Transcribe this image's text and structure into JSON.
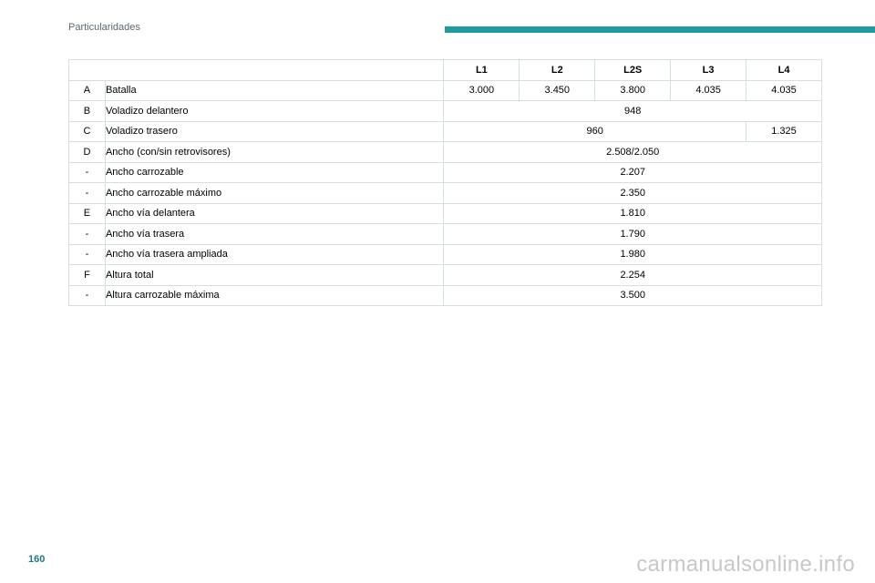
{
  "header": {
    "section_title": "Particularidades",
    "accent_color": "#1f9aa0"
  },
  "table": {
    "columns": [
      "L1",
      "L2",
      "L2S",
      "L3",
      "L4"
    ],
    "rows": [
      {
        "code": "A",
        "label": "Batalla",
        "values": [
          "3.000",
          "3.450",
          "3.800",
          "4.035",
          "4.035"
        ]
      },
      {
        "code": "B",
        "label": "Voladizo delantero",
        "values": [
          "948"
        ]
      },
      {
        "code": "C",
        "label": "Voladizo trasero",
        "values": [
          "960",
          "1.325"
        ]
      },
      {
        "code": "D",
        "label": "Ancho (con/sin retrovisores)",
        "values": [
          "2.508/2.050"
        ]
      },
      {
        "code": "-",
        "label": "Ancho carrozable",
        "values": [
          "2.207"
        ]
      },
      {
        "code": "-",
        "label": "Ancho carrozable máximo",
        "values": [
          "2.350"
        ]
      },
      {
        "code": "E",
        "label": "Ancho vía delantera",
        "values": [
          "1.810"
        ]
      },
      {
        "code": "-",
        "label": "Ancho vía trasera",
        "values": [
          "1.790"
        ]
      },
      {
        "code": "-",
        "label": "Ancho vía trasera ampliada",
        "values": [
          "1.980"
        ]
      },
      {
        "code": "F",
        "label": "Altura total",
        "values": [
          "2.254"
        ]
      },
      {
        "code": "-",
        "label": "Altura carrozable máxima",
        "values": [
          "3.500"
        ]
      }
    ]
  },
  "footer": {
    "page_number": "160",
    "watermark": "carmanualsonline.info"
  }
}
